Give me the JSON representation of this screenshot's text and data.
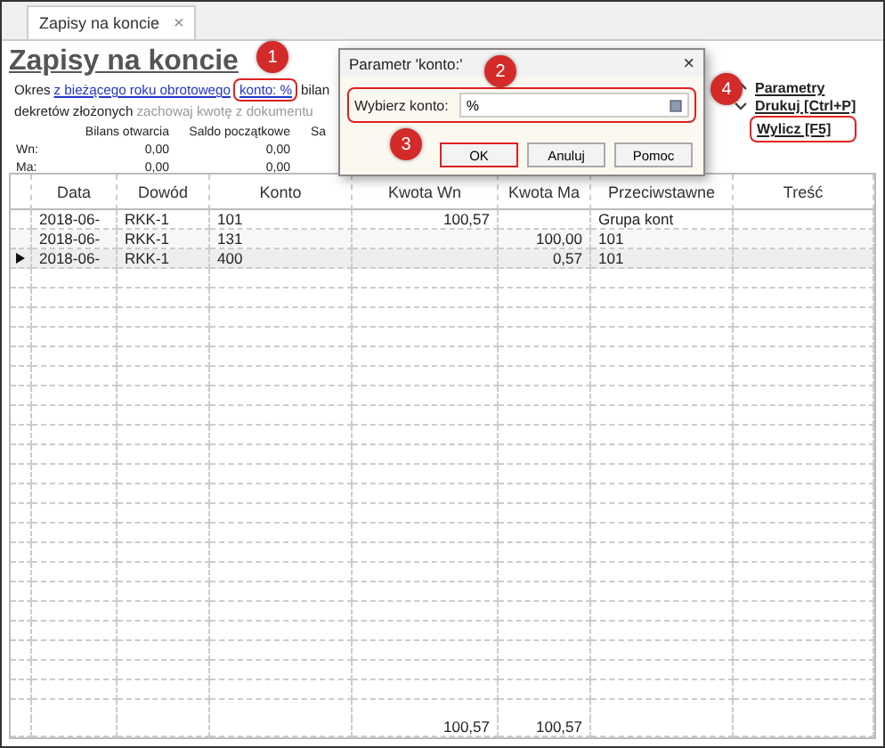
{
  "tabs": [
    {
      "label": "Zapisy na koncie",
      "selected": true,
      "close": "×"
    }
  ],
  "title": "Zapisy na koncie",
  "filter_line": {
    "prefix": "Okres",
    "period_link": "z bieżącego roku obrotowego",
    "account_link": "konto: %",
    "account_highlighted": true,
    "suffix": "bilan"
  },
  "options_line": {
    "text": "dekretów złożonych",
    "option": "zachowaj kwotę z dokumentu"
  },
  "balances": {
    "columns": [
      "Bilans otwarcia",
      "Saldo początkowe",
      "Sa"
    ],
    "rows": [
      {
        "label": "Wn:",
        "values": [
          "0,00",
          "0,00"
        ]
      },
      {
        "label": "Ma:",
        "values": [
          "0,00",
          "0,00"
        ]
      }
    ]
  },
  "actions": [
    {
      "label": "Parametry",
      "highlighted": false
    },
    {
      "label": "Drukuj [Ctrl+P]",
      "highlighted": false
    },
    {
      "label": "Wylicz [F5]",
      "highlighted": true
    }
  ],
  "table": {
    "columns": [
      "Data",
      "Dowód",
      "Konto",
      "Kwota Wn",
      "Kwota Ma",
      "Przeciwstawne",
      "Treść"
    ],
    "rows": [
      {
        "date": "2018-06-",
        "document": "RKK-1",
        "account": "101",
        "debit": "100,57",
        "counter": "Grupa kont",
        "selected": false
      },
      {
        "date": "2018-06-",
        "document": "RKK-1",
        "account": "131",
        "credit": "100,00",
        "counter": "101",
        "selected": false
      },
      {
        "date": "2018-06-",
        "document": "RKK-1",
        "account": "400",
        "credit": "0,57",
        "counter": "101",
        "selected": true
      }
    ],
    "totals": {
      "debit": "100,57",
      "credit": "100,57"
    }
  },
  "dialog": {
    "title": "Parametr 'konto:'",
    "close": "×",
    "field_label": "Wybierz konto:",
    "field_value": "%",
    "field_highlighted": true,
    "buttons": [
      {
        "label": "OK",
        "highlighted": true
      },
      {
        "label": "Anuluj",
        "highlighted": false
      },
      {
        "label": "Pomoc",
        "highlighted": false
      }
    ]
  },
  "annotations": [
    "1",
    "2",
    "3",
    "4"
  ]
}
